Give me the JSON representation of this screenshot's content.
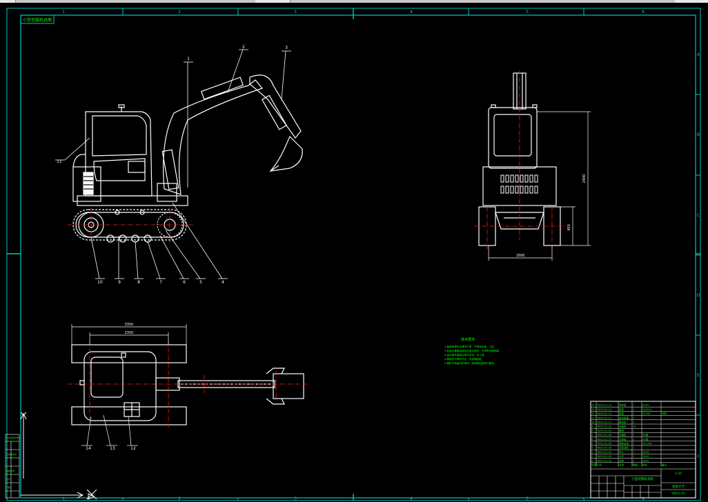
{
  "colors": {
    "background": "#000000",
    "frame": "#00c8c8",
    "geometry": "#ffffff",
    "annotation": "#00ff00",
    "centerline": "#ff2020",
    "table_text": "#00ff00"
  },
  "drawing": {
    "title_stamp": "小型挖掘机总图",
    "column_zones": [
      "1",
      "2",
      "3",
      "4",
      "5",
      "6"
    ],
    "row_zones": [
      "A",
      "B",
      "C",
      "D",
      "E",
      "F"
    ]
  },
  "side_view": {
    "balloons": [
      "1",
      "2",
      "3",
      "4",
      "5",
      "6",
      "7",
      "8",
      "9",
      "10",
      "11"
    ]
  },
  "front_view": {
    "dim_height": "2400",
    "dim_track_height": "450",
    "dim_width": "1600"
  },
  "top_view": {
    "dim_overall": "3350",
    "dim_inner": "2350",
    "balloons": [
      "12",
      "13",
      "14"
    ]
  },
  "tech_notes": {
    "title": "技术要求",
    "lines": [
      "1.装配前零件应清洗干净，不得有毛刺、飞边。",
      "2.各液压管路连接处应密封良好，不得有渗漏现象。",
      "3.运动部件装配后转动灵活，无卡滞。",
      "4.焊接处不得有气孔、夹渣等缺陷。",
      "5.整机外表面涂防锈漆，面漆颜色按用户要求。"
    ]
  },
  "parts_list": {
    "rows": [
      {
        "no": "14",
        "code": "YW15.01.15",
        "name": "驾驶室",
        "qty": "1",
        "material": "Q235",
        "note": ""
      },
      {
        "no": "13",
        "code": "YW15.01.14",
        "name": "机架",
        "qty": "1",
        "material": "Q235-A",
        "note": ""
      },
      {
        "no": "12",
        "code": "YW15.01.13",
        "name": "配重",
        "qty": "1",
        "material": "HT200",
        "note": "外购"
      },
      {
        "no": "11",
        "code": "YW15.01.12",
        "name": "发动机罩",
        "qty": "1",
        "material": "",
        "note": ""
      },
      {
        "no": "10",
        "code": "YW15.01.11",
        "name": "驱动轮",
        "qty": "2",
        "material": "",
        "note": ""
      },
      {
        "no": "9",
        "code": "YW15.01.10",
        "name": "支重轮",
        "qty": "10",
        "material": "",
        "note": ""
      },
      {
        "no": "8",
        "code": "YW15.01.09",
        "name": "履带",
        "qty": "2",
        "material": "",
        "note": ""
      },
      {
        "no": "7",
        "code": "YW15.01.08",
        "name": "托链轮",
        "qty": "2",
        "material": "45钢",
        "note": ""
      },
      {
        "no": "6",
        "code": "YW15.01.07",
        "name": "引导轮",
        "qty": "2",
        "material": "45钢",
        "note": ""
      },
      {
        "no": "5",
        "code": "YW15.01.06",
        "name": "回转支承",
        "qty": "1",
        "material": "42CrMo",
        "note": ""
      },
      {
        "no": "4",
        "code": "YW15.01.05",
        "name": "动臂油缸",
        "qty": "1",
        "material": "",
        "note": ""
      },
      {
        "no": "3",
        "code": "YW15.01.04",
        "name": "铲斗",
        "qty": "1",
        "material": "Q345",
        "note": ""
      },
      {
        "no": "2",
        "code": "YW15.01.03",
        "name": "斗杆",
        "qty": "1",
        "material": "Q345",
        "note": ""
      },
      {
        "no": "1",
        "code": "YW15.01.02",
        "name": "动臂",
        "qty": "1",
        "material": "Q345",
        "note": ""
      }
    ],
    "header": [
      "序号",
      "代号",
      "名称",
      "数量",
      "材料",
      "备注"
    ]
  },
  "title_block": {
    "drawing_name": "小型挖掘机总图",
    "school": "某某大学",
    "drawing_code": "YW15.01",
    "scale": "1:10"
  },
  "left_strip": {
    "labels": [
      "借(通)用件登记",
      "旧底图总号",
      "底图总号",
      "签字",
      "日期"
    ]
  }
}
